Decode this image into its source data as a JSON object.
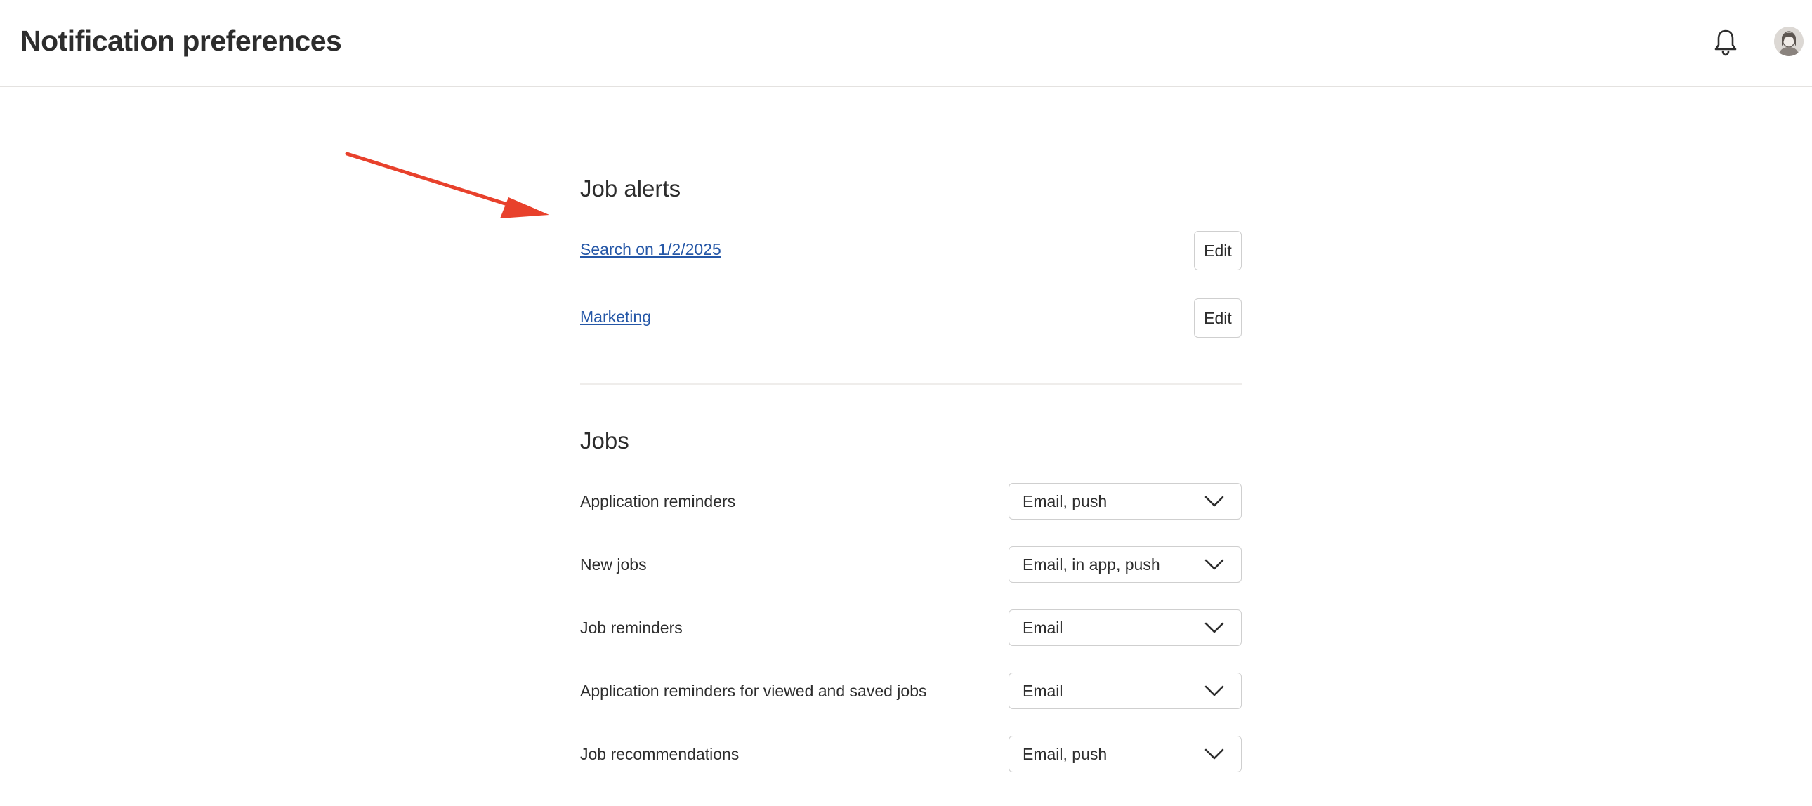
{
  "header": {
    "title": "Notification preferences",
    "icons": {
      "notifications": "bell-icon",
      "profile": "avatar"
    }
  },
  "job_alerts": {
    "title": "Job alerts",
    "items": [
      {
        "label": "Search on 1/2/2025",
        "action": "Edit"
      },
      {
        "label": "Marketing",
        "action": "Edit"
      }
    ]
  },
  "jobs": {
    "title": "Jobs",
    "preferences": [
      {
        "label": "Application reminders",
        "value": "Email, push"
      },
      {
        "label": "New jobs",
        "value": "Email, in app, push"
      },
      {
        "label": "Job reminders",
        "value": "Email"
      },
      {
        "label": "Application reminders for viewed and saved jobs",
        "value": "Email"
      },
      {
        "label": "Job recommendations",
        "value": "Email, push"
      }
    ]
  },
  "colors": {
    "link": "#2557a7",
    "annotation_arrow": "#e8412c",
    "text": "#2d2d2d",
    "border": "#cfcfcf"
  }
}
